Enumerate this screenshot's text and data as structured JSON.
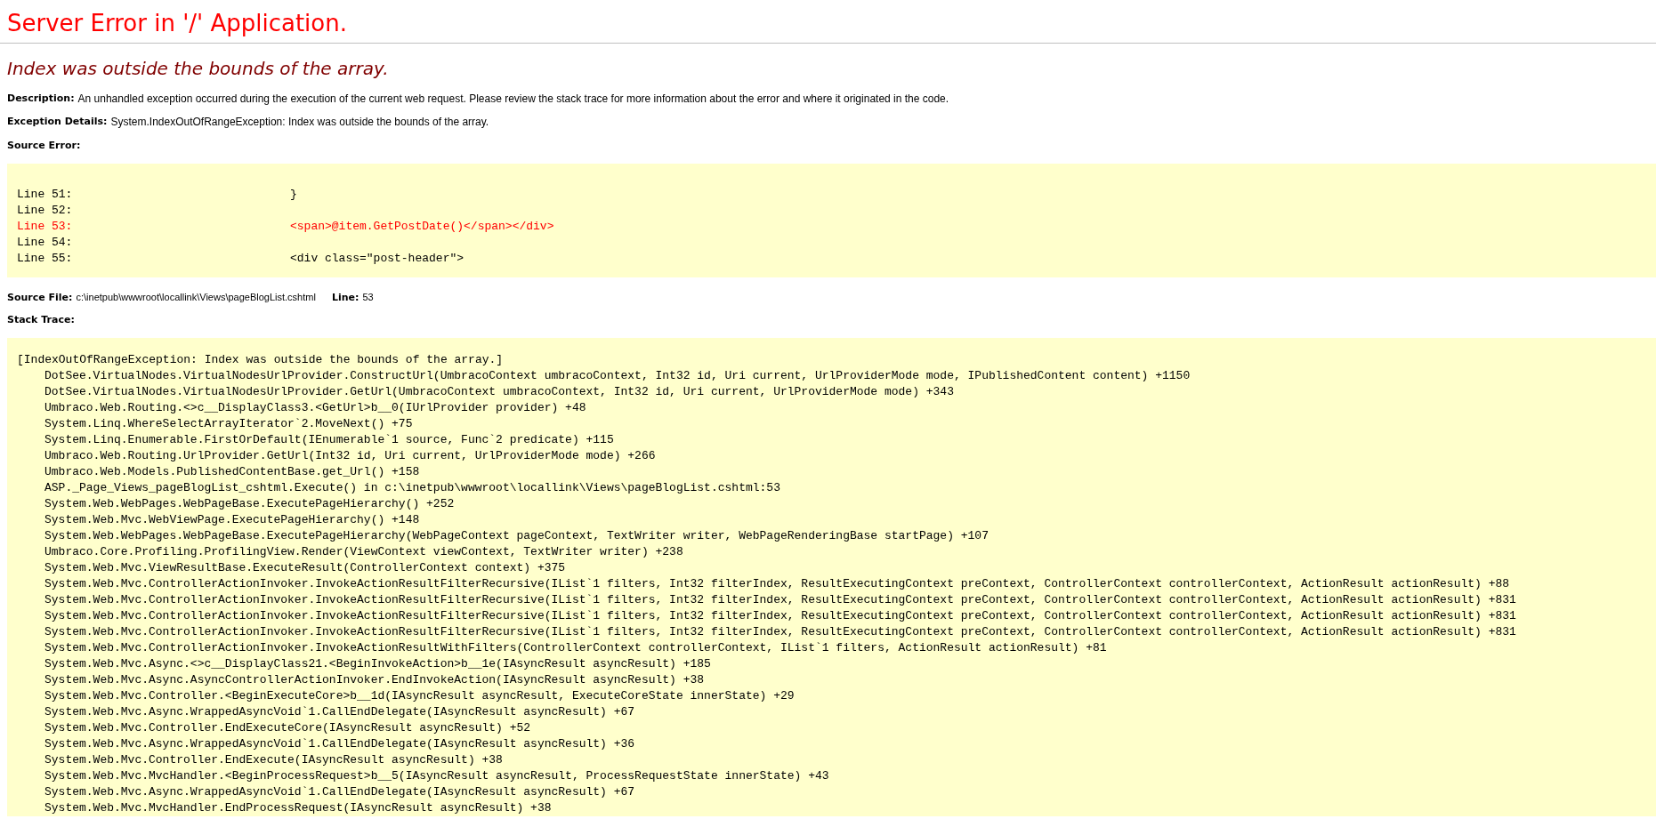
{
  "title": "Server Error in '/' Application.",
  "message": "Index was outside the bounds of the array.",
  "description": {
    "label": "Description:",
    "text": "An unhandled exception occurred during the execution of the current web request. Please review the stack trace for more information about the error and where it originated in the code."
  },
  "exception_details": {
    "label": "Exception Details:",
    "text": "System.IndexOutOfRangeException: Index was outside the bounds of the array."
  },
  "source_error": {
    "label": "Source Error:",
    "lines": [
      {
        "number": "Line 51:",
        "code": "}",
        "error": false
      },
      {
        "number": "Line 52:",
        "error": false
      },
      {
        "number": "Line 53:",
        "code": "<span>@item.GetPostDate()</span></div>",
        "error": true
      },
      {
        "number": "Line 54:",
        "error": false
      },
      {
        "number": "Line 55:",
        "code": "<div class=\"post-header\">",
        "error": false
      }
    ]
  },
  "source_file": {
    "label": "Source File:",
    "path": "c:\\inetpub\\wwwroot\\locallink\\Views\\pageBlogList.cshtml",
    "line_label": "Line:",
    "line": "53"
  },
  "stack_trace": {
    "label": "Stack Trace:",
    "lines": [
      {
        "kind": "exception",
        "text": "[IndexOutOfRangeException: Index was outside the bounds of the array.]"
      },
      {
        "kind": "frame",
        "text": "DotSee.VirtualNodes.VirtualNodesUrlProvider.ConstructUrl(UmbracoContext umbracoContext, Int32 id, Uri current, UrlProviderMode mode, IPublishedContent content) +1150"
      },
      {
        "kind": "frame",
        "text": "DotSee.VirtualNodes.VirtualNodesUrlProvider.GetUrl(UmbracoContext umbracoContext, Int32 id, Uri current, UrlProviderMode mode) +343"
      },
      {
        "kind": "frame",
        "text": "Umbraco.Web.Routing.<>c__DisplayClass3.<GetUrl>b__0(IUrlProvider provider) +48"
      },
      {
        "kind": "frame",
        "text": "System.Linq.WhereSelectArrayIterator`2.MoveNext() +75"
      },
      {
        "kind": "frame",
        "text": "System.Linq.Enumerable.FirstOrDefault(IEnumerable`1 source, Func`2 predicate) +115"
      },
      {
        "kind": "frame",
        "text": "Umbraco.Web.Routing.UrlProvider.GetUrl(Int32 id, Uri current, UrlProviderMode mode) +266"
      },
      {
        "kind": "frame",
        "text": "Umbraco.Web.Models.PublishedContentBase.get_Url() +158"
      },
      {
        "kind": "frame",
        "text": "ASP._Page_Views_pageBlogList_cshtml.Execute() in c:\\inetpub\\wwwroot\\locallink\\Views\\pageBlogList.cshtml:53"
      },
      {
        "kind": "frame",
        "text": "System.Web.WebPages.WebPageBase.ExecutePageHierarchy() +252"
      },
      {
        "kind": "frame",
        "text": "System.Web.Mvc.WebViewPage.ExecutePageHierarchy() +148"
      },
      {
        "kind": "frame",
        "text": "System.Web.WebPages.WebPageBase.ExecutePageHierarchy(WebPageContext pageContext, TextWriter writer, WebPageRenderingBase startPage) +107"
      },
      {
        "kind": "frame",
        "text": "Umbraco.Core.Profiling.ProfilingView.Render(ViewContext viewContext, TextWriter writer) +238"
      },
      {
        "kind": "frame",
        "text": "System.Web.Mvc.ViewResultBase.ExecuteResult(ControllerContext context) +375"
      },
      {
        "kind": "frame",
        "text": "System.Web.Mvc.ControllerActionInvoker.InvokeActionResultFilterRecursive(IList`1 filters, Int32 filterIndex, ResultExecutingContext preContext, ControllerContext controllerContext, ActionResult actionResult) +88"
      },
      {
        "kind": "frame",
        "text": "System.Web.Mvc.ControllerActionInvoker.InvokeActionResultFilterRecursive(IList`1 filters, Int32 filterIndex, ResultExecutingContext preContext, ControllerContext controllerContext, ActionResult actionResult) +831"
      },
      {
        "kind": "frame",
        "text": "System.Web.Mvc.ControllerActionInvoker.InvokeActionResultFilterRecursive(IList`1 filters, Int32 filterIndex, ResultExecutingContext preContext, ControllerContext controllerContext, ActionResult actionResult) +831"
      },
      {
        "kind": "frame",
        "text": "System.Web.Mvc.ControllerActionInvoker.InvokeActionResultFilterRecursive(IList`1 filters, Int32 filterIndex, ResultExecutingContext preContext, ControllerContext controllerContext, ActionResult actionResult) +831"
      },
      {
        "kind": "frame",
        "text": "System.Web.Mvc.ControllerActionInvoker.InvokeActionResultWithFilters(ControllerContext controllerContext, IList`1 filters, ActionResult actionResult) +81"
      },
      {
        "kind": "frame",
        "text": "System.Web.Mvc.Async.<>c__DisplayClass21.<BeginInvokeAction>b__1e(IAsyncResult asyncResult) +185"
      },
      {
        "kind": "frame",
        "text": "System.Web.Mvc.Async.AsyncControllerActionInvoker.EndInvokeAction(IAsyncResult asyncResult) +38"
      },
      {
        "kind": "frame",
        "text": "System.Web.Mvc.Controller.<BeginExecuteCore>b__1d(IAsyncResult asyncResult, ExecuteCoreState innerState) +29"
      },
      {
        "kind": "frame",
        "text": "System.Web.Mvc.Async.WrappedAsyncVoid`1.CallEndDelegate(IAsyncResult asyncResult) +67"
      },
      {
        "kind": "frame",
        "text": "System.Web.Mvc.Controller.EndExecuteCore(IAsyncResult asyncResult) +52"
      },
      {
        "kind": "frame",
        "text": "System.Web.Mvc.Async.WrappedAsyncVoid`1.CallEndDelegate(IAsyncResult asyncResult) +36"
      },
      {
        "kind": "frame",
        "text": "System.Web.Mvc.Controller.EndExecute(IAsyncResult asyncResult) +38"
      },
      {
        "kind": "frame",
        "text": "System.Web.Mvc.MvcHandler.<BeginProcessRequest>b__5(IAsyncResult asyncResult, ProcessRequestState innerState) +43"
      },
      {
        "kind": "frame",
        "text": "System.Web.Mvc.Async.WrappedAsyncVoid`1.CallEndDelegate(IAsyncResult asyncResult) +67"
      },
      {
        "kind": "frame",
        "text": "System.Web.Mvc.MvcHandler.EndProcessRequest(IAsyncResult asyncResult) +38"
      }
    ]
  }
}
